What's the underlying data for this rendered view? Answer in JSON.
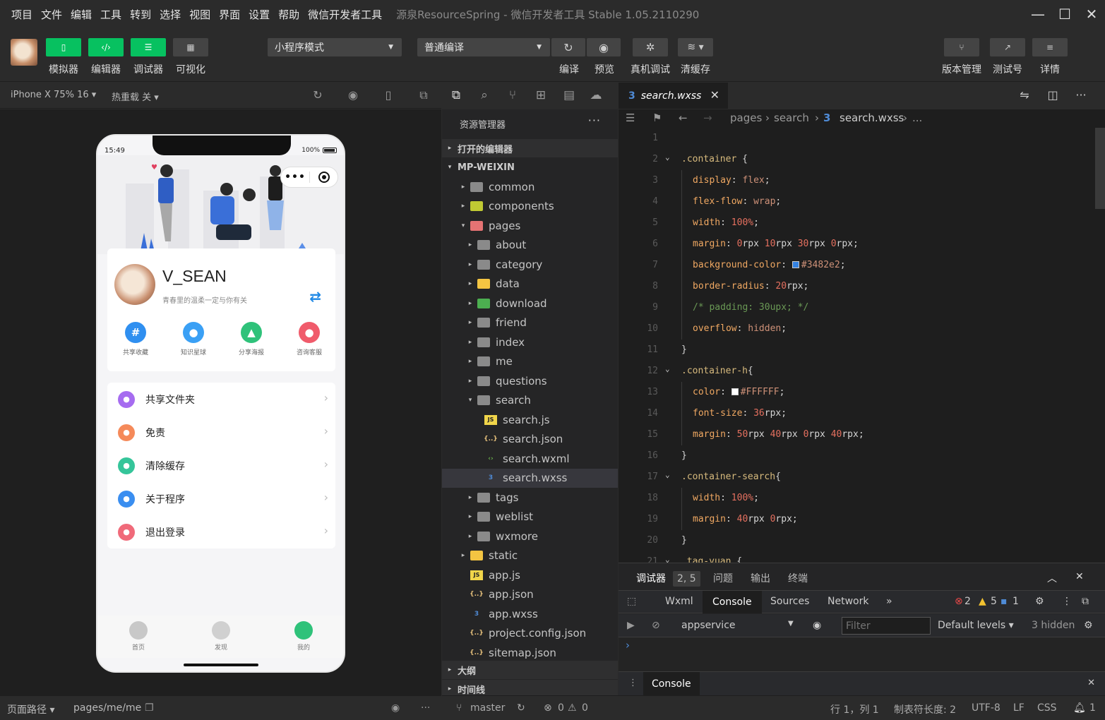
{
  "menubar": {
    "items": [
      "项目",
      "文件",
      "编辑",
      "工具",
      "转到",
      "选择",
      "视图",
      "界面",
      "设置",
      "帮助",
      "微信开发者工具"
    ],
    "window_title": "源泉ResourceSpring - 微信开发者工具 Stable 1.05.2110290"
  },
  "toolbar": {
    "simulator": "模拟器",
    "editor": "编辑器",
    "debugger": "调试器",
    "visual": "可视化",
    "mode_select": "小程序模式",
    "compile_select": "普通编译",
    "compile": "编译",
    "preview": "预览",
    "real_debug": "真机调试",
    "clear_cache": "清缓存",
    "version": "版本管理",
    "test_id": "测试号",
    "details": "详情"
  },
  "simbar": {
    "device": "iPhone X 75% 16 ▾",
    "hotreload": "热重载 关 ▾"
  },
  "phone": {
    "time": "15:49",
    "battery": "100%",
    "username": "V_SEAN",
    "subtitle": "青春里的温柔一定与你有关",
    "quick": [
      {
        "label": "共享收藏",
        "glyph": "#",
        "color": "#2f8ff0"
      },
      {
        "label": "知识星球",
        "glyph": "●",
        "color": "#3aa0f5"
      },
      {
        "label": "分享海报",
        "glyph": "▲",
        "color": "#2fc27a"
      },
      {
        "label": "咨询客服",
        "glyph": "●",
        "color": "#f05b6b"
      }
    ],
    "menu": [
      {
        "label": "共享文件夹",
        "color": "#a66cf0"
      },
      {
        "label": "免责",
        "color": "#f58a5a"
      },
      {
        "label": "清除缓存",
        "color": "#35c59a"
      },
      {
        "label": "关于程序",
        "color": "#3a8ef0"
      },
      {
        "label": "退出登录",
        "color": "#f06a7a"
      }
    ],
    "tabs": [
      "首页",
      "发现",
      "我的"
    ]
  },
  "simstatus": {
    "path_label": "页面路径 ▾",
    "path": "pages/me/me"
  },
  "explorer": {
    "header": "资源管理器",
    "open_editors": "打开的编辑器",
    "project": "MP-WEIXIN",
    "outline": "大纲",
    "timeline": "时间线",
    "tree": [
      {
        "name": "common",
        "indent": 0,
        "twisty": "▸",
        "kind": "folder",
        "color": "#8a8a8a"
      },
      {
        "name": "components",
        "indent": 0,
        "twisty": "▸",
        "kind": "folder",
        "color": "#c0ca33"
      },
      {
        "name": "pages",
        "indent": 0,
        "twisty": "▾",
        "kind": "folder",
        "color": "#e57373"
      },
      {
        "name": "about",
        "indent": 1,
        "twisty": "▸",
        "kind": "folder",
        "color": "#8a8a8a"
      },
      {
        "name": "category",
        "indent": 1,
        "twisty": "▸",
        "kind": "folder",
        "color": "#8a8a8a"
      },
      {
        "name": "data",
        "indent": 1,
        "twisty": "▸",
        "kind": "folder",
        "color": "#f4c542"
      },
      {
        "name": "download",
        "indent": 1,
        "twisty": "▸",
        "kind": "folder",
        "color": "#4caf50"
      },
      {
        "name": "friend",
        "indent": 1,
        "twisty": "▸",
        "kind": "folder",
        "color": "#8a8a8a"
      },
      {
        "name": "index",
        "indent": 1,
        "twisty": "▸",
        "kind": "folder",
        "color": "#8a8a8a"
      },
      {
        "name": "me",
        "indent": 1,
        "twisty": "▸",
        "kind": "folder",
        "color": "#8a8a8a"
      },
      {
        "name": "questions",
        "indent": 1,
        "twisty": "▸",
        "kind": "folder",
        "color": "#8a8a8a"
      },
      {
        "name": "search",
        "indent": 1,
        "twisty": "▾",
        "kind": "folder",
        "color": "#8a8a8a"
      },
      {
        "name": "search.js",
        "indent": 2,
        "twisty": "",
        "kind": "js",
        "color": "#f1d54a"
      },
      {
        "name": "search.json",
        "indent": 2,
        "twisty": "",
        "kind": "json",
        "color": "#e5c07b"
      },
      {
        "name": "search.wxml",
        "indent": 2,
        "twisty": "",
        "kind": "wxml",
        "color": "#6ab04c"
      },
      {
        "name": "search.wxss",
        "indent": 2,
        "twisty": "",
        "kind": "css",
        "color": "#4f8bd6",
        "selected": true
      },
      {
        "name": "tags",
        "indent": 1,
        "twisty": "▸",
        "kind": "folder",
        "color": "#8a8a8a"
      },
      {
        "name": "weblist",
        "indent": 1,
        "twisty": "▸",
        "kind": "folder",
        "color": "#8a8a8a"
      },
      {
        "name": "wxmore",
        "indent": 1,
        "twisty": "▸",
        "kind": "folder",
        "color": "#8a8a8a"
      },
      {
        "name": "static",
        "indent": 0,
        "twisty": "▸",
        "kind": "folder",
        "color": "#f4c542"
      },
      {
        "name": "app.js",
        "indent": 0,
        "twisty": "",
        "kind": "js",
        "color": "#f1d54a"
      },
      {
        "name": "app.json",
        "indent": 0,
        "twisty": "",
        "kind": "json",
        "color": "#e5c07b"
      },
      {
        "name": "app.wxss",
        "indent": 0,
        "twisty": "",
        "kind": "css",
        "color": "#4f8bd6"
      },
      {
        "name": "project.config.json",
        "indent": 0,
        "twisty": "",
        "kind": "json",
        "color": "#e5c07b"
      },
      {
        "name": "sitemap.json",
        "indent": 0,
        "twisty": "",
        "kind": "json",
        "color": "#e5c07b"
      }
    ]
  },
  "editor": {
    "tab": "search.wxss",
    "breadcrumb": [
      "pages",
      "search",
      "search.wxss",
      "..."
    ],
    "lines": [
      [],
      [
        [
          "sel",
          ".container"
        ],
        [
          "plain",
          " {"
        ]
      ],
      [
        [
          "prop",
          "display"
        ],
        [
          "plain",
          ": "
        ],
        [
          "valk",
          "flex"
        ],
        [
          "plain",
          ";"
        ]
      ],
      [
        [
          "prop",
          "flex-flow"
        ],
        [
          "plain",
          ": "
        ],
        [
          "valk",
          "wrap"
        ],
        [
          "plain",
          ";"
        ]
      ],
      [
        [
          "prop",
          "width"
        ],
        [
          "plain",
          ": "
        ],
        [
          "num",
          "100%"
        ],
        [
          "plain",
          ";"
        ]
      ],
      [
        [
          "prop",
          "margin"
        ],
        [
          "plain",
          ": "
        ],
        [
          "num",
          "0"
        ],
        [
          "plain",
          "rpx "
        ],
        [
          "num",
          "10"
        ],
        [
          "plain",
          "rpx "
        ],
        [
          "num",
          "30"
        ],
        [
          "plain",
          "rpx "
        ],
        [
          "num",
          "0"
        ],
        [
          "plain",
          "rpx;"
        ]
      ],
      [
        [
          "prop",
          "background-color"
        ],
        [
          "plain",
          ": "
        ],
        [
          "swatch",
          "#3482e2"
        ],
        [
          "valk",
          "#3482e2"
        ],
        [
          "plain",
          ";"
        ]
      ],
      [
        [
          "prop",
          "border-radius"
        ],
        [
          "plain",
          ": "
        ],
        [
          "num",
          "20"
        ],
        [
          "plain",
          "rpx;"
        ]
      ],
      [
        [
          "cmt",
          "/* padding: 30upx; */"
        ]
      ],
      [
        [
          "prop",
          "overflow"
        ],
        [
          "plain",
          ": "
        ],
        [
          "valk",
          "hidden"
        ],
        [
          "plain",
          ";"
        ]
      ],
      [
        [
          "plain",
          "}"
        ]
      ],
      [
        [
          "sel",
          ".container-h"
        ],
        [
          "plain",
          "{"
        ]
      ],
      [
        [
          "prop",
          "color"
        ],
        [
          "plain",
          ": "
        ],
        [
          "swatch",
          "#FFFFFF"
        ],
        [
          "valk",
          "#FFFFFF"
        ],
        [
          "plain",
          ";"
        ]
      ],
      [
        [
          "prop",
          "font-size"
        ],
        [
          "plain",
          ": "
        ],
        [
          "num",
          "36"
        ],
        [
          "plain",
          "rpx;"
        ]
      ],
      [
        [
          "prop",
          "margin"
        ],
        [
          "plain",
          ": "
        ],
        [
          "num",
          "50"
        ],
        [
          "plain",
          "rpx "
        ],
        [
          "num",
          "40"
        ],
        [
          "plain",
          "rpx "
        ],
        [
          "num",
          "0"
        ],
        [
          "plain",
          "rpx "
        ],
        [
          "num",
          "40"
        ],
        [
          "plain",
          "rpx;"
        ]
      ],
      [
        [
          "plain",
          "}"
        ]
      ],
      [
        [
          "sel",
          ".container-search"
        ],
        [
          "plain",
          "{"
        ]
      ],
      [
        [
          "prop",
          "width"
        ],
        [
          "plain",
          ": "
        ],
        [
          "num",
          "100%"
        ],
        [
          "plain",
          ";"
        ]
      ],
      [
        [
          "prop",
          "margin"
        ],
        [
          "plain",
          ": "
        ],
        [
          "num",
          "40"
        ],
        [
          "plain",
          "rpx "
        ],
        [
          "num",
          "0"
        ],
        [
          "plain",
          "rpx;"
        ]
      ],
      [
        [
          "plain",
          "}"
        ]
      ],
      [
        [
          "sel",
          ".tag-yuan"
        ],
        [
          "plain",
          " {"
        ]
      ]
    ],
    "indented": [
      3,
      4,
      5,
      6,
      7,
      8,
      9,
      10,
      13,
      14,
      15,
      18,
      19
    ],
    "folds": [
      2,
      12,
      17,
      21
    ]
  },
  "debugger": {
    "tab": "调试器",
    "badge": "2, 5",
    "issues": "问题",
    "output": "输出",
    "terminal": "终端",
    "devtabs": [
      "Wxml",
      "Console",
      "Sources",
      "Network"
    ],
    "errors": "2",
    "warnings": "5",
    "infos": "1",
    "context": "appservice",
    "filter_placeholder": "Filter",
    "levels": "Default levels ▾",
    "hidden": "3 hidden",
    "prompt": "›",
    "drawer_tab": "Console"
  },
  "status": {
    "branch": "master",
    "errors": "0",
    "warnings": "0",
    "cursor": "行 1，列 1",
    "tabsize": "制表符长度: 2",
    "encoding": "UTF-8",
    "eol": "LF",
    "lang": "CSS",
    "notif": "1"
  }
}
